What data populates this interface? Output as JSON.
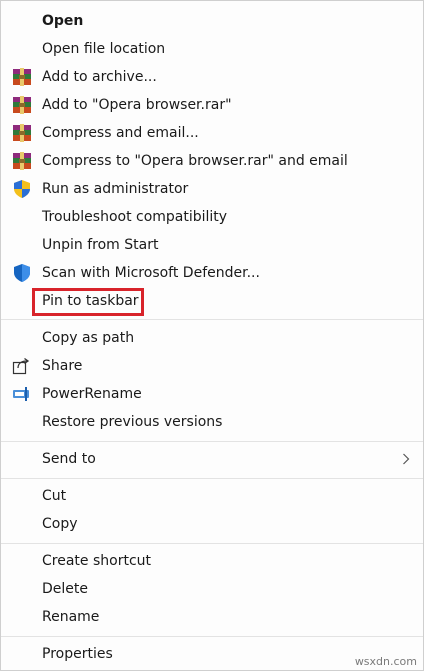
{
  "menu": {
    "items": [
      {
        "id": "open",
        "label": "Open"
      },
      {
        "id": "open-file-location",
        "label": "Open file location"
      },
      {
        "id": "add-to-archive",
        "label": "Add to archive..."
      },
      {
        "id": "add-to-rar",
        "label": "Add to \"Opera browser.rar\""
      },
      {
        "id": "compress-email",
        "label": "Compress and email..."
      },
      {
        "id": "compress-rar-email",
        "label": "Compress to \"Opera browser.rar\" and email"
      },
      {
        "id": "run-as-admin",
        "label": "Run as administrator"
      },
      {
        "id": "troubleshoot",
        "label": "Troubleshoot compatibility"
      },
      {
        "id": "unpin-start",
        "label": "Unpin from Start"
      },
      {
        "id": "scan-defender",
        "label": "Scan with Microsoft Defender..."
      },
      {
        "id": "pin-taskbar",
        "label": "Pin to taskbar"
      },
      {
        "id": "copy-as-path",
        "label": "Copy as path"
      },
      {
        "id": "share",
        "label": "Share"
      },
      {
        "id": "power-rename",
        "label": "PowerRename"
      },
      {
        "id": "restore-versions",
        "label": "Restore previous versions"
      },
      {
        "id": "send-to",
        "label": "Send to"
      },
      {
        "id": "cut",
        "label": "Cut"
      },
      {
        "id": "copy",
        "label": "Copy"
      },
      {
        "id": "create-shortcut",
        "label": "Create shortcut"
      },
      {
        "id": "delete",
        "label": "Delete"
      },
      {
        "id": "rename",
        "label": "Rename"
      },
      {
        "id": "properties",
        "label": "Properties"
      }
    ]
  },
  "icons": {
    "winrar": "winrar-archive-icon",
    "shield": "uac-shield-icon",
    "defender": "defender-shield-icon",
    "share": "share-icon",
    "powerrename": "powerrename-icon",
    "chevron": "chevron-right-icon"
  },
  "colors": {
    "highlight": "#d8232a"
  },
  "watermark": "wsxdn.com"
}
